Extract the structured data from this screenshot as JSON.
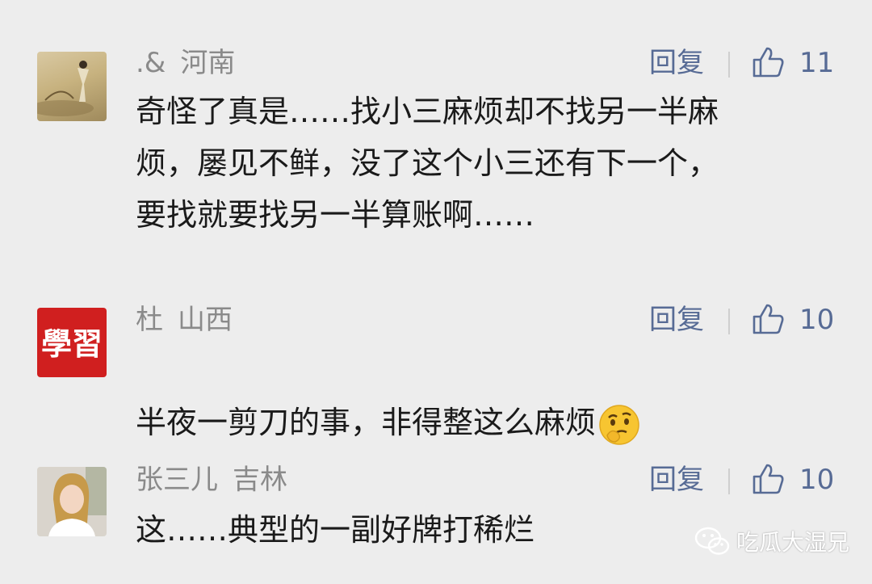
{
  "comments": [
    {
      "user": ".&",
      "region": "河南",
      "reply_label": "回复",
      "likes": "11",
      "text": "奇怪了真是……找小三麻烦却不找另一半麻\n烦，屡见不鲜，没了这个小三还有下一个，\n要找就要找另一半算账啊……",
      "avatar_icon": "landscape-painting-avatar"
    },
    {
      "user": "杜",
      "region": "山西",
      "reply_label": "回复",
      "likes": "10",
      "text": "半夜一剪刀的事，非得整这么麻烦",
      "emoji": "thinking-face-emoji",
      "avatar_icon": "red-calligraphy-avatar",
      "avatar_text": "學習"
    },
    {
      "user": "张三儿",
      "region": "吉林",
      "reply_label": "回复",
      "likes": "10",
      "text": "这……典型的一副好牌打稀烂",
      "avatar_icon": "person-photo-avatar"
    }
  ],
  "watermark": {
    "label": "吃瓜大湿兄",
    "icon": "wechat-icon"
  },
  "colors": {
    "background": "#ededed",
    "link": "#576b95",
    "meta": "#8a8a8a",
    "text": "#1a1a1a"
  }
}
